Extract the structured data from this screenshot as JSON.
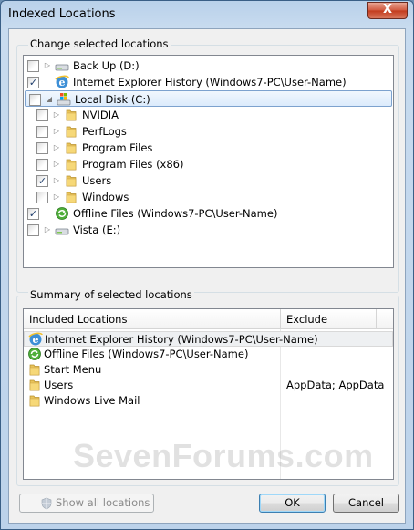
{
  "window": {
    "title": "Indexed Locations",
    "close_label": "X"
  },
  "change_group": {
    "label": "Change selected locations",
    "items": [
      {
        "label": "Back Up (D:)",
        "checked": false,
        "expander": "▷",
        "icon": "drive-icon",
        "level": 0
      },
      {
        "label": "Internet Explorer History (Windows7-PC\\User-Name)",
        "checked": true,
        "expander": "",
        "icon": "ie-icon",
        "level": 0
      },
      {
        "label": "Local Disk (C:)",
        "checked": false,
        "expander": "◢",
        "icon": "windows-drive-icon",
        "level": 0,
        "selected": true
      },
      {
        "label": "NVIDIA",
        "checked": false,
        "expander": "▷",
        "icon": "folder-icon",
        "level": 1
      },
      {
        "label": "PerfLogs",
        "checked": false,
        "expander": "▷",
        "icon": "folder-icon",
        "level": 1
      },
      {
        "label": "Program Files",
        "checked": false,
        "expander": "▷",
        "icon": "folder-icon",
        "level": 1
      },
      {
        "label": "Program Files (x86)",
        "checked": false,
        "expander": "▷",
        "icon": "folder-icon",
        "level": 1
      },
      {
        "label": "Users",
        "checked": true,
        "expander": "▷",
        "icon": "folder-icon",
        "level": 1
      },
      {
        "label": "Windows",
        "checked": false,
        "expander": "▷",
        "icon": "folder-icon",
        "level": 1
      },
      {
        "label": "Offline Files (Windows7-PC\\User-Name)",
        "checked": true,
        "expander": "",
        "icon": "offline-files-icon",
        "level": 0
      },
      {
        "label": "Vista (E:)",
        "checked": false,
        "expander": "▷",
        "icon": "drive-icon",
        "level": 0
      }
    ]
  },
  "summary_group": {
    "label": "Summary of selected locations",
    "columns": {
      "included": "Included Locations",
      "exclude": "Exclude"
    },
    "rows": [
      {
        "included": "Internet Explorer History (Windows7-PC\\User-Name)",
        "exclude": "",
        "icon": "ie-icon",
        "selected": true
      },
      {
        "included": "Offline Files (Windows7-PC\\User-Name)",
        "exclude": "",
        "icon": "offline-files-icon"
      },
      {
        "included": "Start Menu",
        "exclude": "",
        "icon": "folder-icon"
      },
      {
        "included": "Users",
        "exclude": "AppData; AppData",
        "icon": "folder-icon"
      },
      {
        "included": "Windows Live Mail",
        "exclude": "",
        "icon": "folder-icon"
      }
    ]
  },
  "watermark": "SevenForums.com",
  "buttons": {
    "show_all": "Show all locations",
    "ok": "OK",
    "cancel": "Cancel"
  },
  "colors": {
    "selection": "#dcebfc",
    "check": "#1e3d6b",
    "folder": "#e8c35a"
  }
}
